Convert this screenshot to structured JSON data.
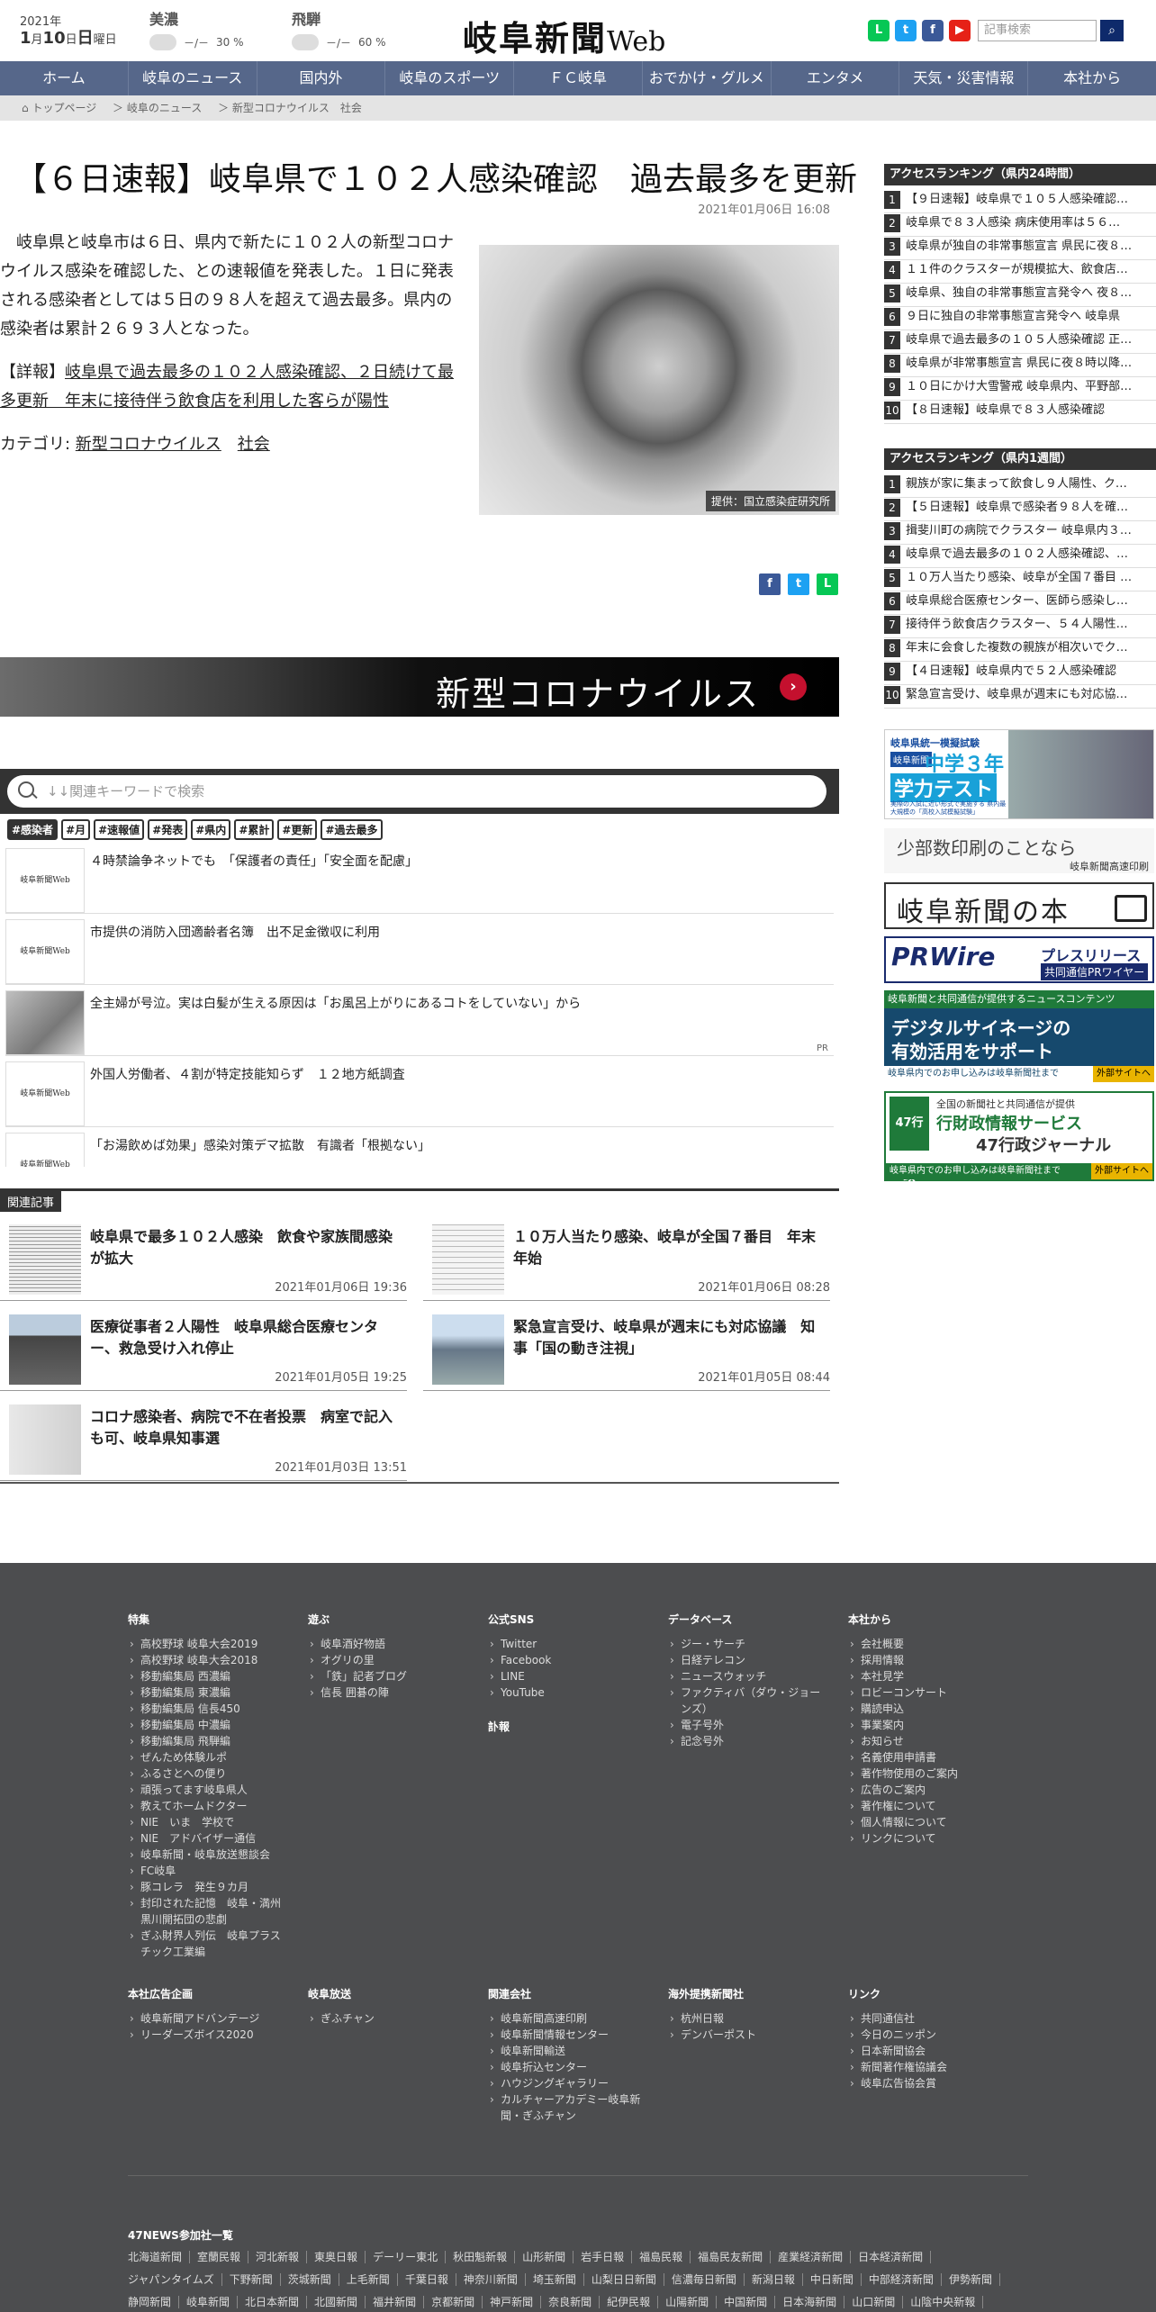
{
  "header": {
    "year": "2021年",
    "month": "1",
    "day": "10",
    "weekday": "日",
    "month_suffix": "月",
    "day_suffix": "日",
    "weekday_suffix": "曜日",
    "weather": [
      {
        "pref": "美濃",
        "temp": "－/－",
        "rain": "30 %"
      },
      {
        "pref": "飛騨",
        "temp": "－/－",
        "rain": "60 %"
      }
    ],
    "logo": "岐阜新聞",
    "logo_web": "Web",
    "search_placeholder": "記事検索",
    "search_icon": "search-icon",
    "sns": [
      "line-icon",
      "twitter-icon",
      "facebook-icon",
      "youtube-icon"
    ],
    "sns_colors": {
      "line": "#06c755",
      "twitter": "#1da1f2",
      "facebook": "#3b5998",
      "youtube": "#e62117"
    }
  },
  "nav": [
    "ホーム",
    "岐阜のニュース",
    "国内外",
    "岐阜のスポーツ",
    "ＦＣ岐阜",
    "おでかけ・グルメ",
    "エンタメ",
    "天気・災害情報",
    "本社から"
  ],
  "breadcrumb": [
    "トップページ",
    "＞ 岐阜のニュース",
    "＞ 新型コロナウイルス　社会"
  ],
  "article": {
    "title": "【６日速報】岐阜県で１０２人感染確認　過去最多を更新",
    "date": "2021年01月06日 16:08",
    "para1": "　岐阜県と岐阜市は６日、県内で新たに１０２人の新型コロナウイルス感染を確認した、との速報値を発表した。１日に発表される感染者としては５日の９８人を超えて過去最多。県内の感染者は累計２６９３人となった。",
    "detail_prefix": "【詳報】",
    "detail_link": "岐阜県で過去最多の１０２人感染確認、２日続けて最多更新　年末に接待伴う飲食店を利用した客らが陽性",
    "category_label": "カテゴリ: ",
    "category_1": "新型コロナウイルス",
    "category_2": "社会",
    "photo_credit": "提供：国立感染症研究所"
  },
  "banner_text": "新型コロナウイルス",
  "keyword_search_placeholder": "↓↓関連キーワードで検索",
  "tags": [
    "#感染者",
    "#月",
    "#速報値",
    "#発表",
    "#県内",
    "#累計",
    "#更新",
    "#過去最多"
  ],
  "feed": [
    {
      "text": "４時禁論争ネットでも　「保護者の責任」「安全面を配慮」",
      "thumb": "岐阜新聞Web"
    },
    {
      "text": "市提供の消防入団適齢者名簿　出不足金徴収に利用",
      "thumb": "岐阜新聞Web"
    },
    {
      "text": "全主婦が号泣。実は白髪が生える原因は「お風呂上がりにあるコトをしていない」から",
      "thumb": "",
      "pr": "PR"
    },
    {
      "text": "外国人労働者、４割が特定技能知らず　１２地方紙調査",
      "thumb": "岐阜新聞Web"
    },
    {
      "text": "「お湯飲めば効果」感染対策デマ拡散　有識者「根拠ない」",
      "thumb": "岐阜新聞Web"
    }
  ],
  "related_label": "関連記事",
  "related": [
    {
      "title": "岐阜県で最多１０２人感染　飲食や家族間感染が拡大",
      "date": "2021年01月06日 19:36"
    },
    {
      "title": "１０万人当たり感染、岐阜が全国７番目　年末年始",
      "date": "2021年01月06日 08:28"
    },
    {
      "title": "医療従事者２人陽性　岐阜県総合医療センター、救急受け入れ停止",
      "date": "2021年01月05日 19:25"
    },
    {
      "title": "緊急宣言受け、岐阜県が週末にも対応協議　知事「国の動き注視」",
      "date": "2021年01月05日 08:44"
    },
    {
      "title": "コロナ感染者、病院で不在者投票　病室で記入も可、岐阜県知事選",
      "date": "2021年01月03日 13:51"
    }
  ],
  "ranking_24h": {
    "title": "アクセスランキング（県内24時間）",
    "items": [
      "【９日速報】岐阜県で１０５人感染確認…",
      "岐阜県で８３人感染 病床使用率は５６…",
      "岐阜県が独自の非常事態宣言 県民に夜８…",
      "１１件のクラスターが規模拡大、飲食店…",
      "岐阜県、独自の非常事態宣言発令へ 夜８…",
      "９日に独自の非常事態宣言発令へ 岐阜県",
      "岐阜県で過去最多の１０５人感染確認 正…",
      "岐阜県が非常事態宣言 県民に夜８時以降…",
      "１０日にかけ大雪警戒 岐阜県内、平野部…",
      "【８日速報】岐阜県で８３人感染確認"
    ]
  },
  "ranking_week": {
    "title": "アクセスランキング（県内1週間）",
    "items": [
      "親族が家に集まって飲食し９人陽性、ク…",
      "【５日速報】岐阜県で感染者９８人を確…",
      "揖斐川町の病院でクラスター 岐阜県内３…",
      "岐阜県で過去最多の１０２人感染確認、…",
      "１０万人当たり感染、岐阜が全国７番目 …",
      "岐阜県総合医療センター、医師ら感染し…",
      "接待伴う飲食店クラスター、５４人陽性…",
      "年末に会食した複数の親族が相次いでク…",
      "【４日速報】岐阜県内で５２人感染確認",
      "緊急宣言受け、岐阜県が週末にも対応協…"
    ]
  },
  "ads": {
    "test_small": "岐阜県統一模擬試験",
    "test_brand": "岐阜新聞",
    "test_big1": "中学３年",
    "test_big2": "学力テスト",
    "test_sub": "実際の入試に近い形式で実施する 県内最大規模の「高校入試模擬試験」",
    "print_main": "少部数印刷のことなら",
    "print_sub": "岐阜新聞高速印刷",
    "book": "岐阜新聞の本",
    "pr_main": "PRWire",
    "pr_right1": "プレスリリース",
    "pr_right2": "共同通信PRワイヤー",
    "signage_top": "岐阜新聞と共同通信が提供するニュースコンテンツ",
    "signage_mid1": "デジタルサイネージの",
    "signage_mid2": "有効活用をサポート",
    "signage_bottom": "岐阜県内でのお申し込みは岐阜新聞社まで",
    "signage_link": "外部サイトへ",
    "gyosei_badge": "47行政",
    "gyosei_top": "全国の新聞社と共同通信が提供",
    "gyosei_mid": "行財政情報サービス",
    "gyosei_name": "47行政ジャーナル",
    "gyosei_bottom": "岐阜県内でのお申し込みは岐阜新聞社まで",
    "gyosei_link": "外部サイトへ"
  },
  "footer": {
    "cols": [
      {
        "title": "特集",
        "items": [
          "高校野球 岐阜大会2019",
          "高校野球 岐阜大会2018",
          "移動編集局 西濃編",
          "移動編集局 東濃編",
          "移動編集局 信長450",
          "移動編集局 中濃編",
          "移動編集局 飛騨編",
          "ぜんため体験ルポ",
          "ふるさとへの便り",
          "頑張ってます岐阜県人",
          "教えてホームドクター",
          "NIE　いま　学校で",
          "NIE　アドバイザー通信",
          "岐阜新聞・岐阜放送懇談会",
          "FC岐阜",
          "豚コレラ　発生９カ月",
          "封印された記憶　岐阜・満州黒川開拓団の悲劇",
          "ぎふ財界人列伝　岐阜プラスチック工業編"
        ]
      },
      {
        "title": "遊ぶ",
        "items": [
          "岐阜酒好物語",
          "オグリの里",
          "「鉄」記者ブログ",
          "信長 囲碁の陣"
        ]
      },
      {
        "title": "公式SNS",
        "items": [
          "Twitter",
          "Facebook",
          "LINE",
          "YouTube"
        ],
        "extra": "訃報"
      },
      {
        "title": "データベース",
        "items": [
          "ジー・サーチ",
          "日経テレコン",
          "ニュースウォッチ",
          "ファクティバ（ダウ・ジョーンズ）",
          "電子号外",
          "記念号外"
        ]
      },
      {
        "title": "本社から",
        "items": [
          "会社概要",
          "採用情報",
          "本社見学",
          "ロビーコンサート",
          "購読申込",
          "事業案内",
          "お知らせ",
          "名義使用申請書",
          "著作物使用のご案内",
          "広告のご案内",
          "著作権について",
          "個人情報について",
          "リンクについて"
        ]
      }
    ],
    "cols2": [
      {
        "title": "本社広告企画",
        "items": [
          "岐阜新聞アドバンテージ",
          "リーダーズボイス2020"
        ]
      },
      {
        "title": "岐阜放送",
        "items": [
          "ぎふチャン"
        ]
      },
      {
        "title": "関連会社",
        "items": [
          "岐阜新聞高速印刷",
          "岐阜新聞情報センター",
          "岐阜新聞輸送",
          "岐阜折込センター",
          "ハウジングギャラリー",
          "カルチャーアカデミー岐阜新聞・ぎふチャン"
        ]
      },
      {
        "title": "海外提携新聞社",
        "items": [
          "杭州日報",
          "デンバーポスト"
        ]
      },
      {
        "title": "リンク",
        "items": [
          "共同通信社",
          "今日のニッポン",
          "日本新聞協会",
          "新聞著作権協議会",
          "岐阜広告協会賞"
        ]
      }
    ],
    "papers_title": "47NEWS参加社一覧",
    "papers": [
      [
        "北海道新聞",
        "室蘭民報",
        "河北新報",
        "東奥日報",
        "デーリー東北",
        "秋田魁新報",
        "山形新聞",
        "岩手日報",
        "福島民報",
        "福島民友新聞",
        "産業経済新聞",
        "日本経済新聞"
      ],
      [
        "ジャパンタイムズ",
        "下野新聞",
        "茨城新聞",
        "上毛新聞",
        "千葉日報",
        "神奈川新聞",
        "埼玉新聞",
        "山梨日日新聞",
        "信濃毎日新聞",
        "新潟日報",
        "中日新聞",
        "中部経済新聞",
        "伊勢新聞"
      ],
      [
        "静岡新聞",
        "岐阜新聞",
        "北日本新聞",
        "北國新聞",
        "福井新聞",
        "京都新聞",
        "神戸新聞",
        "奈良新聞",
        "紀伊民報",
        "山陽新聞",
        "中国新聞",
        "日本海新聞",
        "山口新聞",
        "山陰中央新報"
      ]
    ]
  }
}
